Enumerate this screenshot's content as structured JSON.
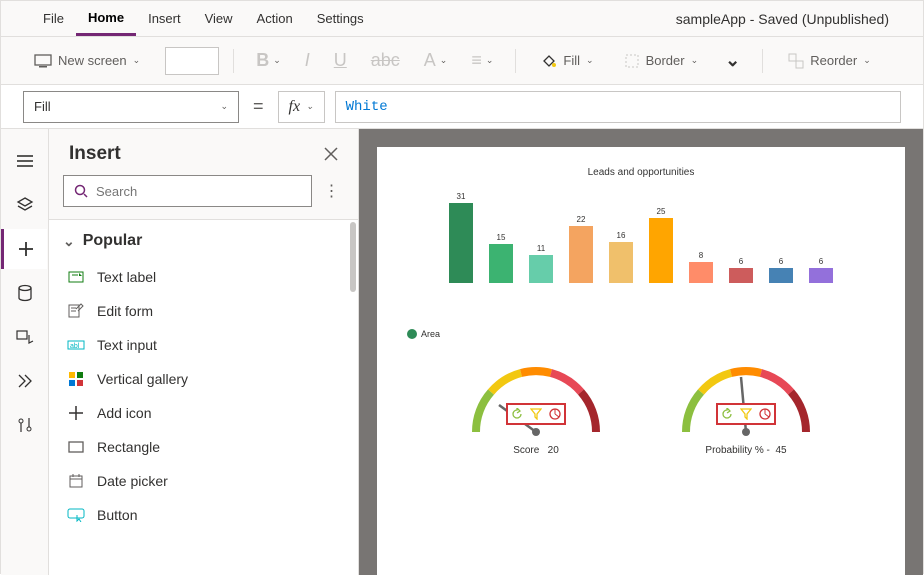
{
  "app_title": "sampleApp - Saved (Unpublished)",
  "menu": {
    "file": "File",
    "home": "Home",
    "insert": "Insert",
    "view": "View",
    "action": "Action",
    "settings": "Settings"
  },
  "ribbon": {
    "new_screen": "New screen",
    "fill": "Fill",
    "border": "Border",
    "reorder": "Reorder"
  },
  "formula_bar": {
    "property": "Fill",
    "fx": "fx",
    "value": "White"
  },
  "insert_panel": {
    "title": "Insert",
    "search_placeholder": "Search",
    "category": "Popular",
    "items": [
      "Text label",
      "Edit form",
      "Text input",
      "Vertical gallery",
      "Add icon",
      "Rectangle",
      "Date picker",
      "Button"
    ]
  },
  "canvas": {
    "chart_title": "Leads and opportunities",
    "legend": "Area",
    "gauge1_label": "Score",
    "gauge1_value": "20",
    "gauge2_label": "Probability % -",
    "gauge2_value": "45"
  },
  "chart_data": {
    "type": "bar",
    "title": "Leads and opportunities",
    "categories": [
      "",
      "",
      "",
      "",
      "",
      "",
      "",
      "",
      "",
      ""
    ],
    "values": [
      31,
      15,
      11,
      22,
      16,
      25,
      8,
      6,
      6,
      6
    ],
    "colors": [
      "#2e8b57",
      "#3cb371",
      "#66cdaa",
      "#f4a460",
      "#f0c06b",
      "#ffa500",
      "#ff8c69",
      "#cd5c5c",
      "#4682b4",
      "#9370db"
    ],
    "ylim": [
      0,
      31
    ]
  }
}
